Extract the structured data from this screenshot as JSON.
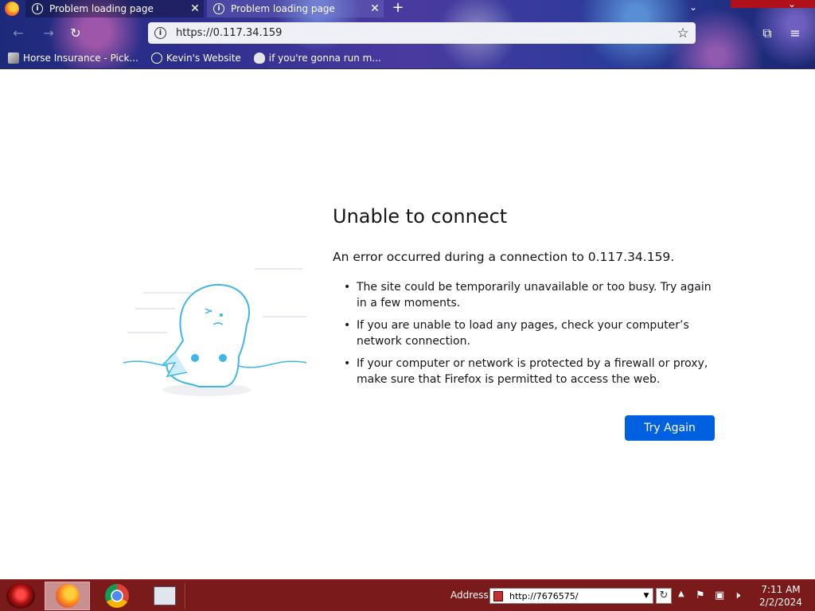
{
  "browser": {
    "tabs": [
      {
        "title": "Problem loading page"
      },
      {
        "title": "Problem loading page"
      }
    ],
    "url": "https://0.117.34.159",
    "bookmarks": [
      {
        "label": "Horse Insurance - Pick...",
        "icon": "horse-icon"
      },
      {
        "label": "Kevin's Website",
        "icon": "globe-icon"
      },
      {
        "label": "if you're gonna run m...",
        "icon": "skull-icon"
      }
    ]
  },
  "error": {
    "title": "Unable to connect",
    "subtitle": "An error occurred during a connection to 0.117.34.159.",
    "reasons": [
      "The site could be temporarily unavailable or too busy. Try again in a few moments.",
      "If you are unable to load any pages, check your computer’s network connection.",
      "If your computer or network is protected by a firewall or proxy, make sure that Firefox is permitted to access the web."
    ],
    "button": "Try Again",
    "accent": "#0061e0"
  },
  "taskbar": {
    "address_label": "Address",
    "address_value": "http://7676575/",
    "time": "7:11 AM",
    "date": "2/2/2024",
    "color": "#7a1a1a"
  }
}
